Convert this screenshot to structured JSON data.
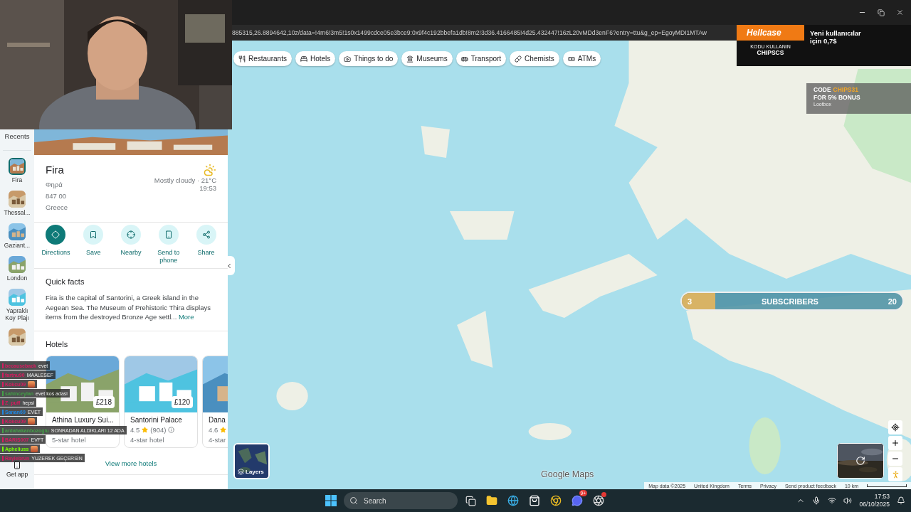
{
  "browser": {
    "url": "885315,26.8894642,10z/data=!4m6!3m5!1s0x1499cdce05e3bce9:0x9f4c192bbefa1db!8m2!3d36.4166485!4d25.432447!16zL20vMDd3enF6?entry=ttu&g_ep=EgoyMDI1MTAw"
  },
  "rail": {
    "title": "Recents",
    "items": [
      {
        "label": "Fira",
        "selected": true
      },
      {
        "label": "Thessal...",
        "selected": false
      },
      {
        "label": "Gaziant...",
        "selected": false
      },
      {
        "label": "London",
        "selected": false
      },
      {
        "label": "Yapraklı Koy Plajı",
        "selected": false
      }
    ],
    "get_app": "Get app"
  },
  "place": {
    "name": "Fira",
    "native_name": "Φηρά",
    "postcode": "847 00",
    "country": "Greece",
    "weather": "Mostly cloudy · 21°C",
    "local_time": "19:53",
    "actions": [
      {
        "kind": "directions",
        "label": "Directions"
      },
      {
        "kind": "save",
        "label": "Save"
      },
      {
        "kind": "nearby",
        "label": "Nearby"
      },
      {
        "kind": "send",
        "label": "Send to phone"
      },
      {
        "kind": "share",
        "label": "Share"
      }
    ]
  },
  "quick_facts": {
    "title": "Quick facts",
    "text": "Fira is the capital of Santorini, a Greek island in the Aegean Sea. The Museum of Prehistoric Thira displays items from the destroyed Bronze Age settl...",
    "more": "More"
  },
  "hotels": {
    "title": "Hotels",
    "items": [
      {
        "price": "£218",
        "name": "Athina Luxury Sui...",
        "class": "5-star hotel"
      },
      {
        "price": "£120",
        "name": "Santorini Palace",
        "rating": "4.5",
        "reviews": "(904)",
        "class": "4-star hotel"
      },
      {
        "name": "Dana",
        "rating": "4.6",
        "class": "4-star"
      }
    ],
    "view_more": "View more hotels"
  },
  "chips": [
    {
      "kind": "restaurants",
      "label": "Restaurants"
    },
    {
      "kind": "hotels",
      "label": "Hotels"
    },
    {
      "kind": "things",
      "label": "Things to do"
    },
    {
      "kind": "museums",
      "label": "Museums"
    },
    {
      "kind": "transport",
      "label": "Transport"
    },
    {
      "kind": "chemists",
      "label": "Chemists"
    },
    {
      "kind": "atms",
      "label": "ATMs"
    }
  ],
  "map": {
    "brand": "Google Maps",
    "layers": "Layers",
    "footer": [
      "Map data ©2025",
      "United Kingdom",
      "Terms",
      "Privacy",
      "Send product feedback"
    ],
    "scale": "10 km"
  },
  "chat": [
    {
      "user": "becauseback",
      "kind": "text",
      "message": "evet",
      "color": "#d81b60"
    },
    {
      "user": "fartnu90",
      "kind": "text",
      "message": "MAALESEF",
      "color": "#d81b60"
    },
    {
      "user": "Kokcu09",
      "kind": "emote",
      "color": "#d81b60"
    },
    {
      "user": "sahinceylan",
      "kind": "text",
      "message": "evet kos adasi",
      "color": "#43a047"
    },
    {
      "user": "Z_puff",
      "kind": "text",
      "message": "hepsi",
      "color": "#d81b60"
    },
    {
      "user": "Sanan69",
      "kind": "text",
      "message": "EVET",
      "color": "#1e88e5"
    },
    {
      "user": "Kokcu09",
      "kind": "emote",
      "color": "#d81b60"
    },
    {
      "user": "ardahakanbozoglu",
      "kind": "text",
      "message": "SONRADAN ALDIKLARI 12 ADA",
      "color": "#43a047"
    },
    {
      "user": "BARIS007",
      "kind": "text",
      "message": "EVFT",
      "color": "#d81b60"
    },
    {
      "user": "Apheliuss",
      "kind": "emote",
      "color": "#76ff03"
    },
    {
      "user": "Raylebrun",
      "kind": "text",
      "message": "YUZEREK GEÇERSİN",
      "color": "#d81b60"
    }
  ],
  "overlays": {
    "subscribers": {
      "current": "3",
      "label": "SUBSCRIBERS",
      "goal": "20",
      "level": 0.15
    },
    "ad": {
      "brand": "Hellcase",
      "code_label": "KODU KULLANIN",
      "code": "CHIPSCS",
      "headline": "Yeni kullanıcılar",
      "offer": "için 0,7$"
    },
    "ad2": {
      "code_label": "CODE",
      "code": "CHIPS31",
      "offer": "FOR 5% BONUS",
      "brand": "Lootbox"
    }
  },
  "taskbar": {
    "search": "Search",
    "badge": "9+",
    "time": "17:53",
    "date": "06/10/2025"
  }
}
